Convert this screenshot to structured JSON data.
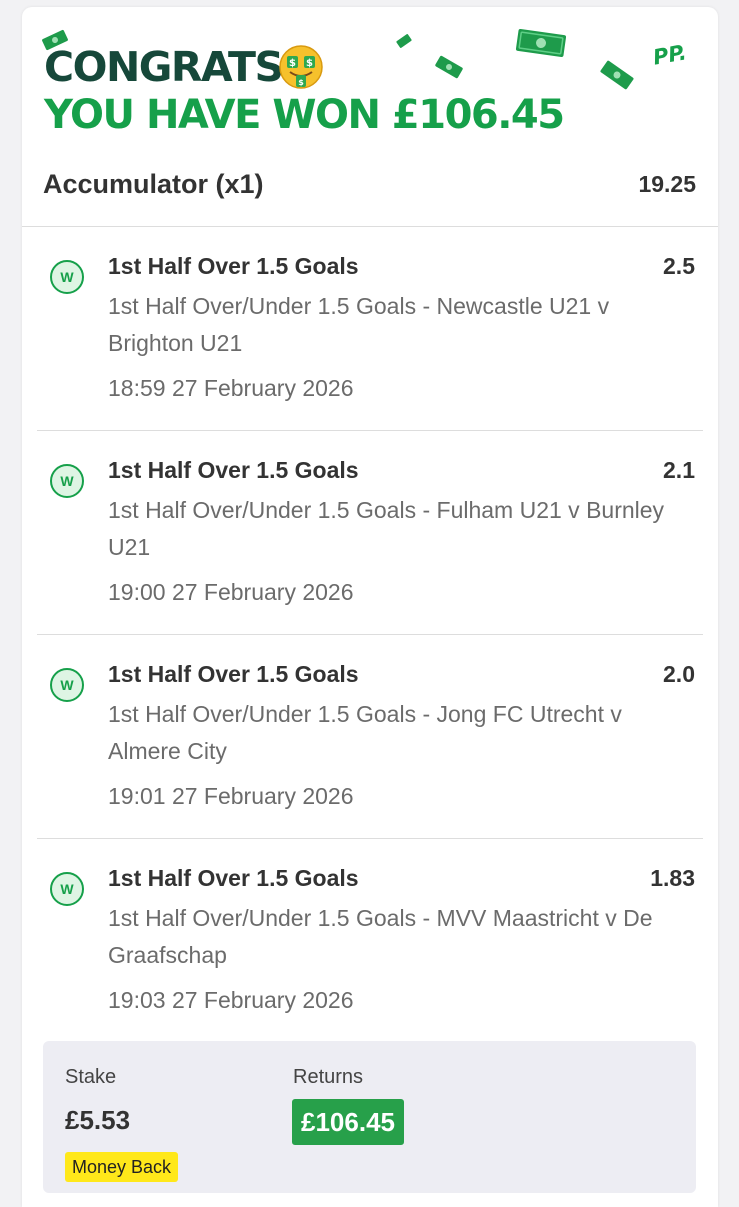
{
  "banner": {
    "congrats": "CONGRATS!",
    "won_text": "YOU HAVE WON £106.45",
    "brand_mark": "PP.",
    "brand_green": "#16a04a",
    "brand_dark": "#16483a"
  },
  "accumulator": {
    "title": "Accumulator (x1)",
    "odds": "19.25"
  },
  "legs": [
    {
      "status": "W",
      "selection": "1st Half Over 1.5 Goals",
      "odds": "2.5",
      "market": "1st Half Over/Under 1.5 Goals - Newcastle U21 v Brighton U21",
      "time": "18:59 27 February 2026"
    },
    {
      "status": "W",
      "selection": "1st Half Over 1.5 Goals",
      "odds": "2.1",
      "market": "1st Half Over/Under 1.5 Goals - Fulham U21 v Burnley U21",
      "time": "19:00 27 February 2026"
    },
    {
      "status": "W",
      "selection": "1st Half Over 1.5 Goals",
      "odds": "2.0",
      "market": "1st Half Over/Under 1.5 Goals - Jong FC Utrecht v Almere City",
      "time": "19:01 27 February 2026"
    },
    {
      "status": "W",
      "selection": "1st Half Over 1.5 Goals",
      "odds": "1.83",
      "market": "1st Half Over/Under 1.5 Goals - MVV Maastricht v De Graafschap",
      "time": "19:03 27 February 2026"
    }
  ],
  "summary": {
    "stake_label": "Stake",
    "stake_value": "£5.53",
    "returns_label": "Returns",
    "returns_value": "£106.45",
    "promo_badge": "Money Back"
  },
  "icons": {
    "emoji": "money-mouth-face-icon",
    "confetti": "banknote-icon",
    "leg_status": "win-badge-icon"
  }
}
